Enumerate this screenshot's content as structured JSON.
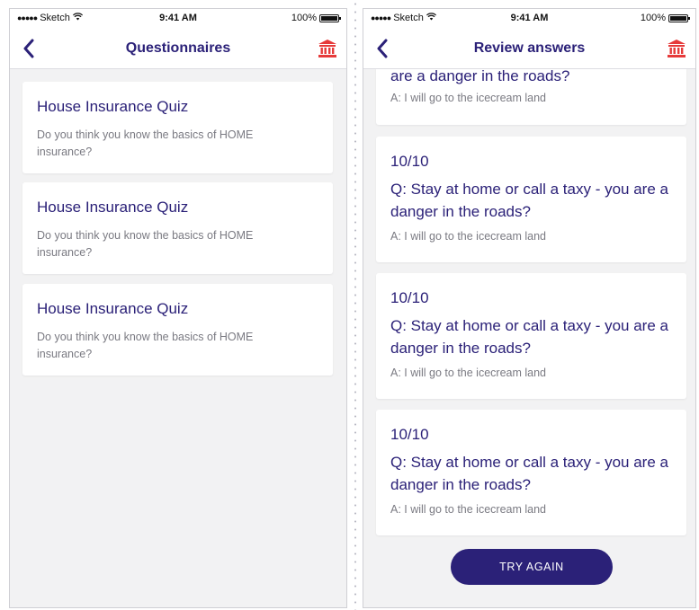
{
  "status": {
    "carrier": "Sketch",
    "time": "9:41 AM",
    "battery": "100%"
  },
  "left_screen": {
    "title": "Questionnaires",
    "quizzes": [
      {
        "title": "House Insurance Quiz",
        "description": "Do you think you know the basics of HOME insurance?"
      },
      {
        "title": "House Insurance Quiz",
        "description": "Do you think you know the basics of HOME insurance?"
      },
      {
        "title": "House Insurance Quiz",
        "description": "Do you think you know the basics of HOME insurance?"
      }
    ]
  },
  "right_screen": {
    "title": "Review answers",
    "partial": {
      "question": "are a danger in the roads?",
      "answer": "A: I will go to the icecream land"
    },
    "answers": [
      {
        "score": "10/10",
        "question": "Q: Stay at home or call a taxy - you are a danger in the roads?",
        "answer": "A: I will go to the icecream land"
      },
      {
        "score": "10/10",
        "question": "Q: Stay at home or call a taxy - you are a danger in the roads?",
        "answer": "A: I will go to the icecream land"
      },
      {
        "score": "10/10",
        "question": "Q: Stay at home or call a taxy - you are a danger in the roads?",
        "answer": "A: I will go to the icecream land"
      }
    ],
    "button_label": "TRY AGAIN"
  },
  "icons": {
    "back": "chevron-left-icon",
    "bank": "bank-building-icon",
    "wifi": "wifi-icon",
    "battery": "battery-icon"
  },
  "colors": {
    "primary": "#2b2178",
    "accent_red": "#e63a3a",
    "background": "#f2f2f3",
    "card": "#ffffff",
    "muted_text": "#7a7a82"
  }
}
